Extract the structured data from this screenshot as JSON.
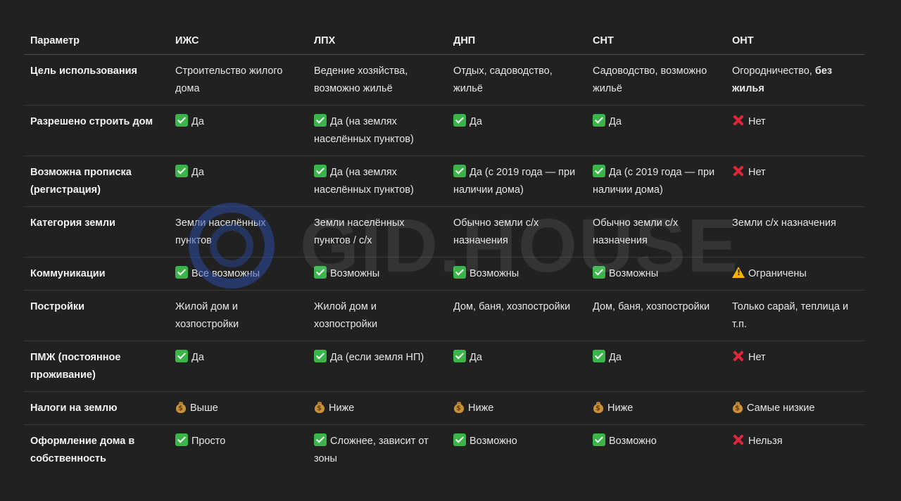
{
  "watermark": {
    "text": "GID.HOUSE",
    "color": "#2c4eaa"
  },
  "colors": {
    "background": "#212121",
    "check": "#3bb54a",
    "cross": "#e0263a",
    "warn": "#f4b400"
  },
  "table": {
    "headers": [
      "Параметр",
      "ИЖС",
      "ЛПХ",
      "ДНП",
      "СНТ",
      "ОНТ"
    ],
    "rows": [
      {
        "param": "Цель использования",
        "cells": [
          {
            "icon": "",
            "text": "Строительство жилого дома"
          },
          {
            "icon": "",
            "text": "Ведение хозяйства, возможно жильё"
          },
          {
            "icon": "",
            "text": "Отдых, садоводство, жильё"
          },
          {
            "icon": "",
            "text": "Садоводство, возможно жильё"
          },
          {
            "icon": "",
            "text": "Огородничество, ",
            "bold": "без жилья"
          }
        ]
      },
      {
        "param": "Разрешено строить дом",
        "cells": [
          {
            "icon": "check-icon",
            "text": "Да"
          },
          {
            "icon": "check-icon",
            "text": "Да (на землях населённых пунктов)"
          },
          {
            "icon": "check-icon",
            "text": "Да"
          },
          {
            "icon": "check-icon",
            "text": "Да"
          },
          {
            "icon": "cross-icon",
            "text": "Нет"
          }
        ]
      },
      {
        "param": "Возможна прописка (регистрация)",
        "cells": [
          {
            "icon": "check-icon",
            "text": "Да"
          },
          {
            "icon": "check-icon",
            "text": "Да (на землях населённых пунктов)"
          },
          {
            "icon": "check-icon",
            "text": "Да (с 2019 года — при наличии дома)"
          },
          {
            "icon": "check-icon",
            "text": "Да (с 2019 года — при наличии дома)"
          },
          {
            "icon": "cross-icon",
            "text": "Нет"
          }
        ]
      },
      {
        "param": "Категория земли",
        "cells": [
          {
            "icon": "",
            "text": "Земли населённых пунктов"
          },
          {
            "icon": "",
            "text": "Земли населённых пунктов / с/х"
          },
          {
            "icon": "",
            "text": "Обычно земли с/х назначения"
          },
          {
            "icon": "",
            "text": "Обычно земли с/х назначения"
          },
          {
            "icon": "",
            "text": "Земли с/х назначения"
          }
        ]
      },
      {
        "param": "Коммуникации",
        "cells": [
          {
            "icon": "check-icon",
            "text": "Все возможны"
          },
          {
            "icon": "check-icon",
            "text": "Возможны"
          },
          {
            "icon": "check-icon",
            "text": "Возможны"
          },
          {
            "icon": "check-icon",
            "text": "Возможны"
          },
          {
            "icon": "warning-icon",
            "text": "Ограничены"
          }
        ]
      },
      {
        "param": "Постройки",
        "cells": [
          {
            "icon": "",
            "text": "Жилой дом и хозпостройки"
          },
          {
            "icon": "",
            "text": "Жилой дом и хозпостройки"
          },
          {
            "icon": "",
            "text": "Дом, баня, хозпостройки"
          },
          {
            "icon": "",
            "text": "Дом, баня, хозпостройки"
          },
          {
            "icon": "",
            "text": "Только сарай, теплица и т.п."
          }
        ]
      },
      {
        "param": "ПМЖ (постоянное проживание)",
        "cells": [
          {
            "icon": "check-icon",
            "text": "Да"
          },
          {
            "icon": "check-icon",
            "text": "Да (если земля НП)"
          },
          {
            "icon": "check-icon",
            "text": "Да"
          },
          {
            "icon": "check-icon",
            "text": "Да"
          },
          {
            "icon": "cross-icon",
            "text": "Нет"
          }
        ]
      },
      {
        "param": "Налоги на землю",
        "cells": [
          {
            "icon": "money-bag-icon",
            "text": "Выше"
          },
          {
            "icon": "money-bag-icon",
            "text": "Ниже"
          },
          {
            "icon": "money-bag-icon",
            "text": "Ниже"
          },
          {
            "icon": "money-bag-icon",
            "text": "Ниже"
          },
          {
            "icon": "money-bag-icon",
            "text": "Самые низкие"
          }
        ]
      },
      {
        "param": "Оформление дома в собственность",
        "cells": [
          {
            "icon": "check-icon",
            "text": "Просто"
          },
          {
            "icon": "check-icon",
            "text": "Сложнее, зависит от зоны"
          },
          {
            "icon": "check-icon",
            "text": "Возможно"
          },
          {
            "icon": "check-icon",
            "text": "Возможно"
          },
          {
            "icon": "cross-icon",
            "text": "Нельзя"
          }
        ]
      }
    ]
  }
}
